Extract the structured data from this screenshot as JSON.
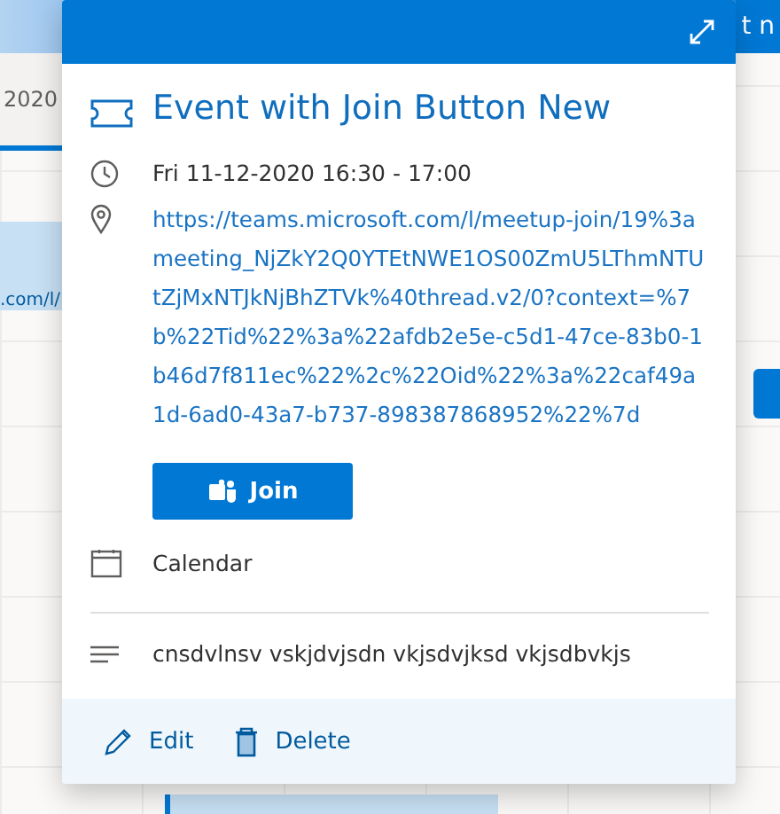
{
  "background": {
    "year_label": "2020",
    "header_fragment": "t n",
    "link_fragment": ".com/l/"
  },
  "popup": {
    "title": "Event with Join Button New",
    "time": "Fri 11-12-2020 16:30 - 17:00",
    "location": "https://teams.microsoft.com/l/meetup-join/19%3ameeting_NjZkY2Q0YTEtNWE1OS00ZmU5LThmNTUtZjMxNTJkNjBhZTVk%40thread.v2/0?context=%7b%22Tid%22%3a%22afdb2e5e-c5d1-47ce-83b0-1b46d7f811ec%22%2c%22Oid%22%3a%22caf49a1d-6ad0-43a7-b737-898387868952%22%7d",
    "join_button": "Join",
    "calendar": "Calendar",
    "description": "cnsdvlnsv vskjdvjsdn vkjsdvjksd vkjsdbvkjs",
    "actions": [
      {
        "kind": "edit",
        "label": "Edit"
      },
      {
        "kind": "delete",
        "label": "Delete"
      }
    ]
  }
}
